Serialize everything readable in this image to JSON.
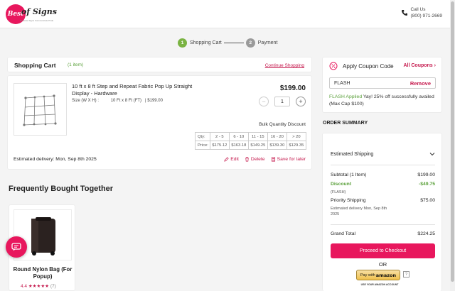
{
  "header": {
    "logo_text": "of Signs",
    "logo_badge": "Best",
    "logo_tagline": "Because Signs Communicate Pride",
    "call_label": "Call Us",
    "call_number": "(800) 971-2669"
  },
  "steps": [
    {
      "number": "1",
      "label": "Shopping Cart",
      "active": true
    },
    {
      "number": "2",
      "label": "Payment",
      "active": false
    }
  ],
  "cart": {
    "title": "Shopping Cart",
    "count": "(1 item)",
    "continue_label": "Continue Shopping",
    "item": {
      "name": "10 ft x 8 ft Step and Repeat Fabric Pop Up Straight Display - Hardware",
      "size_label": "Size (W X H) :",
      "size_value": "10 Ft x 8 Ft (FT)",
      "size_price": "| $199.00",
      "price": "$199.00",
      "minus": "−",
      "quantity": "1",
      "plus": "+",
      "bulk_title": "Bulk Quantity Discount",
      "bulk_qty_label": "Qty:",
      "bulk_price_label": "Price:",
      "bulk_qty": [
        "2 - 5",
        "6 - 10",
        "11 - 15",
        "16 - 20",
        "> 20"
      ],
      "bulk_price": [
        "$175.12",
        "$163.18",
        "$149.25",
        "$139.30",
        "$129.35"
      ],
      "estimated_delivery": "Estimated delivery: Mon, Sep 8th 2025",
      "edit_label": "Edit",
      "delete_label": "Delete",
      "save_label": "Save for later"
    }
  },
  "fbt": {
    "title": "Frequently Bought Together",
    "product_name": "Round Nylon Bag (For Popup)",
    "rating": "4.4",
    "stars": "★★★★★",
    "reviews": "(7)"
  },
  "coupon": {
    "title": "Apply Coupon Code",
    "all_coupons": "All Coupons",
    "code": "FLASH",
    "remove": "Remove",
    "applied_label": "FLASH Applied",
    "applied_msg": "Yay! 25% off successfully availed (Max Cap $100)"
  },
  "summary": {
    "heading": "ORDER SUMMARY",
    "shipping_label": "Estimated Shipping",
    "subtotal_label": "Subtotal (1 Item)",
    "subtotal_value": "$199.00",
    "discount_label": "Discount",
    "discount_value": "-$49.75",
    "discount_code": "(FLASH)",
    "priority_label": "Priority Shipping",
    "priority_value": "$75.00",
    "priority_note": "Estimated delivery Mon, Sep 8th 2025",
    "grand_total_label": "Grand Total",
    "grand_total_value": "$224.25",
    "checkout_label": "Proceed to Checkout",
    "or_label": "OR",
    "amazon_pay_label": "Pay with",
    "amazon_brand": "amazon",
    "amazon_help": "?",
    "amazon_sub": "USE YOUR AMAZON ACCOUNT"
  },
  "colors": {
    "brand": "#e8175d",
    "accent_green": "#7ab342",
    "link": "#c5194d"
  }
}
